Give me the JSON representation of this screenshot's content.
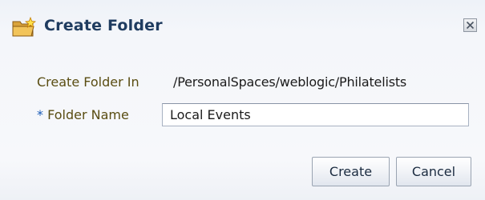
{
  "dialog": {
    "title": "Create Folder",
    "title_icon": "new-folder-icon",
    "close_icon": "close-icon"
  },
  "form": {
    "location_label": "Create Folder In",
    "location_value": "/PersonalSpaces/weblogic/Philatelists",
    "required_marker": "*",
    "name_label": "Folder Name",
    "name_value": "Local Events"
  },
  "buttons": {
    "create_label": "Create",
    "cancel_label": "Cancel"
  },
  "colors": {
    "title_text": "#1f3c60",
    "label_text": "#5a4d12",
    "required_marker": "#1a5bb7"
  }
}
